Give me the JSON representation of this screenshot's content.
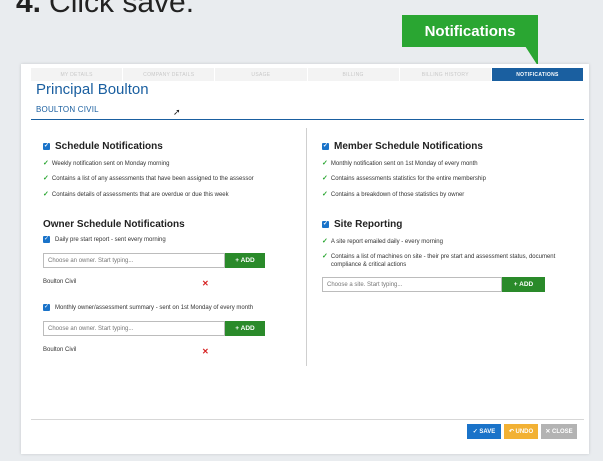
{
  "step": {
    "number": "4.",
    "text": "Click save."
  },
  "callout": {
    "label": "Notifications"
  },
  "tabs": [
    {
      "label": "MY DETAILS",
      "active": false
    },
    {
      "label": "COMPANY DETAILS",
      "active": false
    },
    {
      "label": "USAGE",
      "active": false
    },
    {
      "label": "BILLING",
      "active": false
    },
    {
      "label": "BILLING HISTORY",
      "active": false
    },
    {
      "label": "NOTIFICATIONS",
      "active": true
    }
  ],
  "header": {
    "title": "Principal Boulton",
    "subtitle": "BOULTON CIVIL"
  },
  "schedule": {
    "title": "Schedule Notifications",
    "items": [
      "Weekly notification sent on Monday morning",
      "Contains a list of any assessments that have been assigned to the assessor",
      "Contains details of assessments that are overdue or due this week"
    ]
  },
  "owner_schedule": {
    "title": "Owner Schedule Notifications",
    "daily": {
      "label": "Daily pre start report - sent every morning",
      "placeholder": "Choose an owner. Start typing...",
      "add_label": "+ ADD",
      "owner": "Boulton Civil"
    },
    "monthly": {
      "label": "Monthly owner/assessment summary - sent on 1st Monday of every month",
      "placeholder": "Choose an owner. Start typing...",
      "add_label": "+ ADD",
      "owner": "Boulton Civil"
    }
  },
  "member_schedule": {
    "title": "Member Schedule Notifications",
    "items": [
      "Monthly notification sent on 1st Monday of every month",
      "Contains assessments statistics for the entire membership",
      "Contains a breakdown of those statistics by owner"
    ]
  },
  "site_reporting": {
    "title": "Site Reporting",
    "items": [
      "A site report emailed daily - every morning",
      "Contains a list of machines on site - their pre start and assessment status, document compliance & critical actions"
    ],
    "placeholder": "Choose a site. Start typing...",
    "add_label": "+ ADD"
  },
  "footer": {
    "save": "SAVE",
    "undo": "UNDO",
    "close": "CLOSE"
  },
  "colors": {
    "accent": "#1a5fa0",
    "green": "#2aa632",
    "add_green": "#2a8a2a",
    "undo": "#f2b134",
    "close": "#b3b3b3"
  },
  "icons": {
    "tick": "check-icon",
    "remove": "remove-icon",
    "cursor": "mouse-cursor-icon"
  }
}
